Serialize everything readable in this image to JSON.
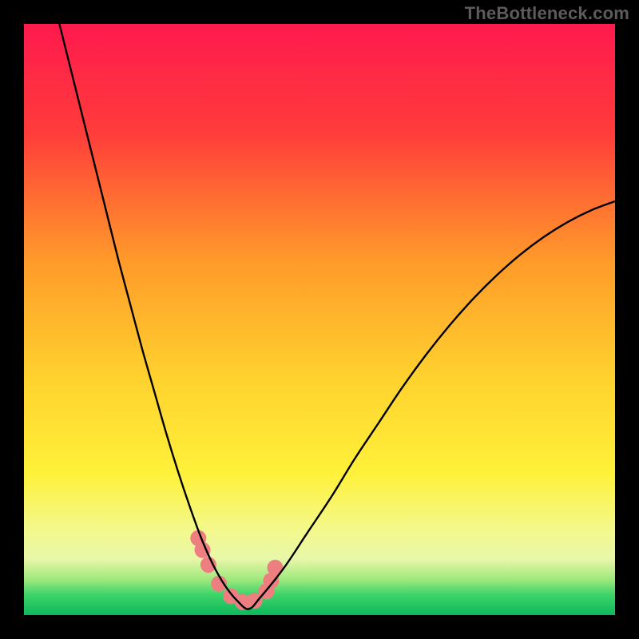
{
  "watermark": "TheBottleneck.com",
  "chart_data": {
    "type": "line",
    "title": "",
    "xlabel": "",
    "ylabel": "",
    "xlim": [
      0,
      100
    ],
    "ylim": [
      0,
      100
    ],
    "series": [
      {
        "name": "curve",
        "x": [
          6,
          8,
          10,
          12,
          14,
          16,
          18,
          20,
          22,
          24,
          26,
          28,
          30,
          32,
          34,
          36,
          38,
          40,
          44,
          48,
          52,
          56,
          60,
          64,
          68,
          72,
          76,
          80,
          84,
          88,
          92,
          96,
          100
        ],
        "values": [
          100,
          92,
          84,
          76,
          68,
          60,
          52.5,
          45,
          38,
          31,
          24.5,
          18.5,
          13,
          8.5,
          5,
          2.5,
          1,
          3,
          8,
          14,
          20,
          26.5,
          32.5,
          38.5,
          44,
          49,
          53.5,
          57.5,
          61,
          64,
          66.5,
          68.5,
          70
        ]
      },
      {
        "name": "markers",
        "x": [
          29.5,
          30.2,
          31.2,
          33,
          35,
          37,
          39,
          41,
          41.8,
          42.5
        ],
        "values": [
          13,
          11,
          8.5,
          5.3,
          3.2,
          2.2,
          2.4,
          4.0,
          5.8,
          8.0
        ]
      }
    ],
    "gradient_stops": [
      {
        "offset": 0.0,
        "color": "#ff1a4d"
      },
      {
        "offset": 0.18,
        "color": "#ff3b3b"
      },
      {
        "offset": 0.4,
        "color": "#ff9a2a"
      },
      {
        "offset": 0.6,
        "color": "#ffd22e"
      },
      {
        "offset": 0.76,
        "color": "#fff13a"
      },
      {
        "offset": 0.86,
        "color": "#f3f98f"
      },
      {
        "offset": 0.905,
        "color": "#e8f7a8"
      },
      {
        "offset": 0.94,
        "color": "#9fe87d"
      },
      {
        "offset": 0.965,
        "color": "#3fd46a"
      },
      {
        "offset": 1.0,
        "color": "#0db85a"
      }
    ],
    "marker_color": "#ed7f80",
    "marker_radius_px": 10,
    "curve_color": "#000000"
  }
}
